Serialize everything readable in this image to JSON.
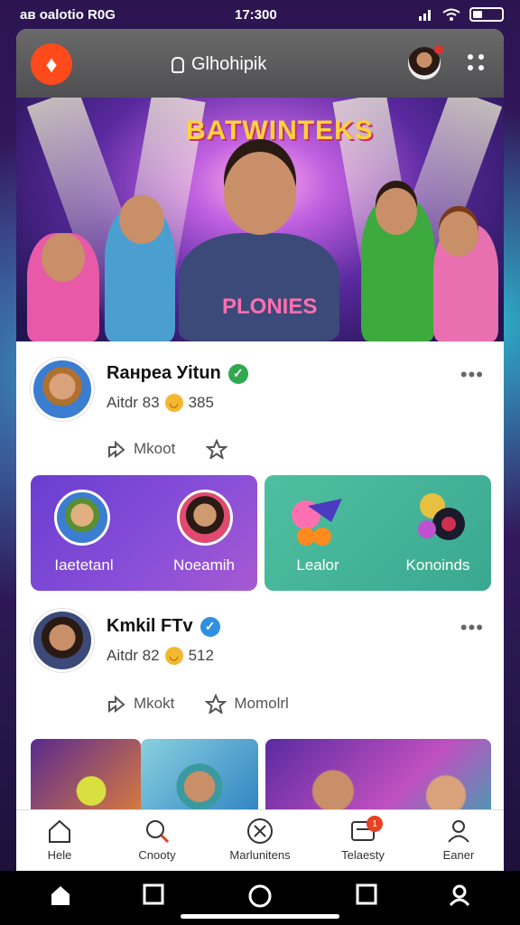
{
  "status_bar": {
    "left": "aʙ oalotio R0G",
    "time": "17:300"
  },
  "header": {
    "title": "Glhohipik",
    "logo_icon": "logo-icon",
    "avatar": "profile-avatar",
    "menu_icon": "grid-menu-icon"
  },
  "hero": {
    "title": "BATWINTEKS",
    "shirt_text": "PLONIES"
  },
  "post1": {
    "name": "Rанреа Уitun",
    "meta_prefix": "Aitdr 83",
    "meta_value": "385",
    "action1": "Mkoot",
    "action2": "",
    "verified_color": "#2fa84f"
  },
  "cards": [
    {
      "label_left": "Iaetetanl",
      "label_right": "Noeamih"
    },
    {
      "label_left": "Lealor",
      "label_right": "Konoinds"
    }
  ],
  "post2": {
    "name": "Kmkil FTv",
    "meta_prefix": "Aitdr 82",
    "meta_value": "512",
    "action1": "Mkokt",
    "action2": "Momolrl",
    "verified_color": "#2f8fe0"
  },
  "nav": [
    {
      "label": "Hele",
      "icon": "home-icon"
    },
    {
      "label": "Cnooty",
      "icon": "search-icon"
    },
    {
      "label": "Marlunitens",
      "icon": "compass-icon"
    },
    {
      "label": "Telaesty",
      "icon": "inbox-icon",
      "badge": "1"
    },
    {
      "label": "Eaner",
      "icon": "profile-icon"
    }
  ]
}
